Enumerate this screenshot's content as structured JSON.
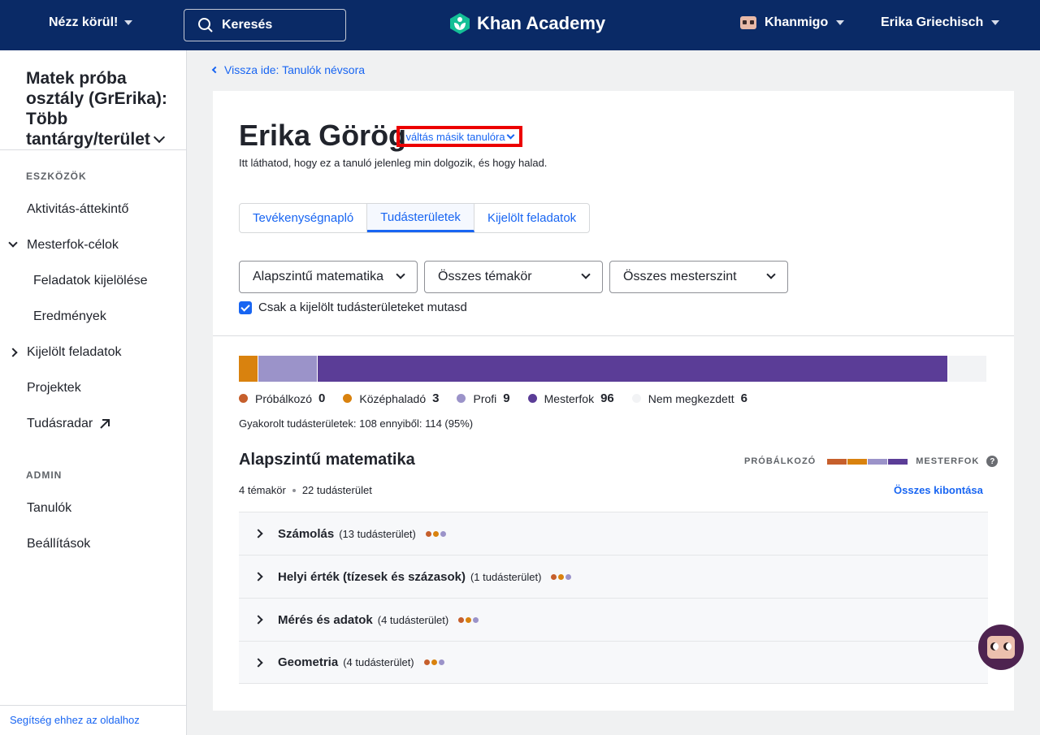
{
  "topbar": {
    "explore_label": "Nézz körül!",
    "search_placeholder": "Keresés",
    "logo_text": "Khan Academy",
    "khanmigo_label": "Khanmigo",
    "user_name": "Erika Griechisch"
  },
  "sidebar": {
    "class_title": "Matek próba osztály (GrErika): Több tantárgy/terület",
    "section_tools": "ESZKÖZÖK",
    "items": [
      {
        "label": "Aktivitás-áttekintő"
      },
      {
        "label": "Mesterfok-célok"
      },
      {
        "label": "Feladatok kijelölése"
      },
      {
        "label": "Eredmények"
      },
      {
        "label": "Kijelölt feladatok"
      },
      {
        "label": "Projektek"
      },
      {
        "label": "Tudásradar"
      }
    ],
    "section_admin": "ADMIN",
    "admin_items": [
      {
        "label": "Tanulók"
      },
      {
        "label": "Beállítások"
      }
    ],
    "help_link": "Segítség ehhez az oldalhoz"
  },
  "main": {
    "back_link": "Vissza ide: Tanulók névsora",
    "student_name": "Erika Görög",
    "switch_student": "váltás másik tanulóra",
    "subtitle": "Itt láthatod, hogy ez a tanuló jelenleg min dolgozik, és hogy halad.",
    "tabs": [
      {
        "label": "Tevékenységnapló",
        "active": false
      },
      {
        "label": "Tudásterületek",
        "active": true
      },
      {
        "label": "Kijelölt feladatok",
        "active": false
      }
    ],
    "filters": {
      "course": "Alapszintű matematika",
      "unit": "Összes témakör",
      "level": "Összes mesterszint"
    },
    "checkbox_label": "Csak a kijelölt tudásterületeket mutasd",
    "checkbox_checked": true,
    "progress": {
      "total": 114,
      "levels": [
        {
          "name": "Próbálkozó",
          "count": 0,
          "color": "#c65f2c"
        },
        {
          "name": "Középhaladó",
          "count": 3,
          "color": "#d9820e"
        },
        {
          "name": "Profi",
          "count": 9,
          "color": "#9b93c9"
        },
        {
          "name": "Mesterfok",
          "count": 96,
          "color": "#5b3d97"
        },
        {
          "name": "Nem megkezdett",
          "count": 6,
          "color": "#f2f3f5"
        }
      ]
    },
    "practiced_text": "Gyakorolt tudásterületek: 108 ennyiből: 114 (95%)",
    "course_title": "Alapszintű matematika",
    "scale_left": "PRÓBÁLKOZÓ",
    "scale_right": "MESTERFOK",
    "scale_help": "?",
    "meta_units": "4 témakör",
    "meta_skills": "22 tudásterület",
    "expand_all": "Összes kibontása",
    "units": [
      {
        "name": "Számolás",
        "count": "(13 tudásterület)"
      },
      {
        "name": "Helyi érték (tízesek és százasok)",
        "count": "(1 tudásterület)"
      },
      {
        "name": "Mérés és adatok",
        "count": "(4 tudásterület)"
      },
      {
        "name": "Geometria",
        "count": "(4 tudásterület)"
      }
    ]
  }
}
